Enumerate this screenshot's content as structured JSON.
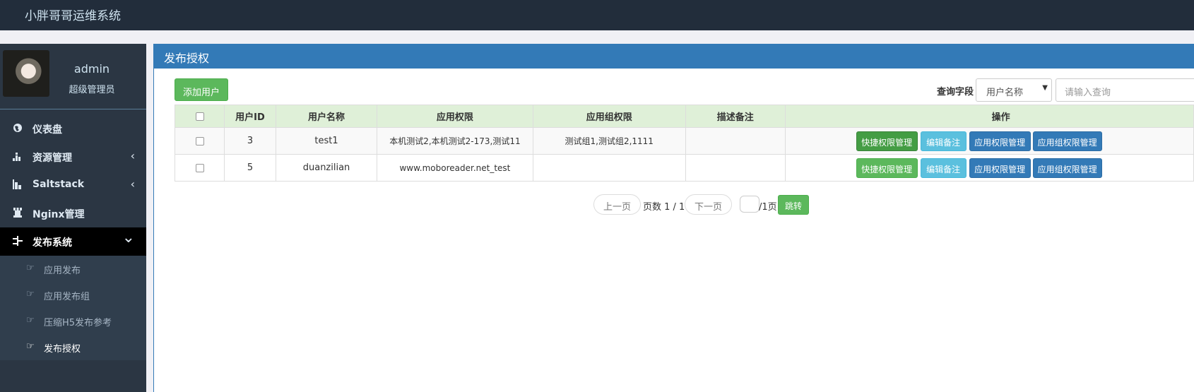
{
  "app_title": "小胖哥哥运维系统",
  "user": {
    "name": "admin",
    "role": "超级管理员"
  },
  "sidebar": {
    "items": [
      {
        "label": "仪表盘",
        "icon": "globe-icon",
        "arrow": ""
      },
      {
        "label": "资源管理",
        "icon": "sitemap-icon",
        "arrow": "‹"
      },
      {
        "label": "Saltstack",
        "icon": "bar-chart-icon",
        "arrow": "‹"
      },
      {
        "label": "Nginx管理",
        "icon": "chess-rook-icon",
        "arrow": ""
      },
      {
        "label": "发布系统",
        "icon": "tasks-icon",
        "arrow": "⌄"
      }
    ],
    "sub_items": [
      {
        "label": "应用发布",
        "icon": "hand-point-right-icon"
      },
      {
        "label": "应用发布组",
        "icon": "hand-point-right-icon"
      },
      {
        "label": "压缩H5发布参考",
        "icon": "hand-point-right-icon"
      },
      {
        "label": "发布授权",
        "icon": "hand-point-right-icon"
      }
    ]
  },
  "panel": {
    "title": "发布授权",
    "add_user_label": "添加用户",
    "search": {
      "label": "查询字段",
      "selected": "用户名称",
      "placeholder": "请输入查询"
    }
  },
  "table": {
    "headers": [
      "",
      "用户ID",
      "用户名称",
      "应用权限",
      "应用组权限",
      "描述备注",
      "操作"
    ],
    "rows": [
      {
        "id": "3",
        "name": "test1",
        "app_perm": "本机测试2,本机测试2-173,测试11",
        "group_perm": "测试组1,测试组2,1111",
        "remark": ""
      },
      {
        "id": "5",
        "name": "duanzilian",
        "app_perm": "www.moboreader.net_test",
        "group_perm": "",
        "remark": ""
      }
    ],
    "actions": [
      "快捷权限管理",
      "编辑备注",
      "应用权限管理",
      "应用组权限管理"
    ]
  },
  "pager": {
    "prev": "上一页",
    "page_info": "页数 1 / 1",
    "next": "下一页",
    "total_pages": "/1页",
    "jump": "跳转"
  },
  "colors": {
    "topbar": "#222d3b",
    "sidebar": "#2b3643",
    "panel_header": "#337ab7",
    "success": "#5cb85c",
    "info": "#5bc0de",
    "primary": "#337ab7"
  }
}
